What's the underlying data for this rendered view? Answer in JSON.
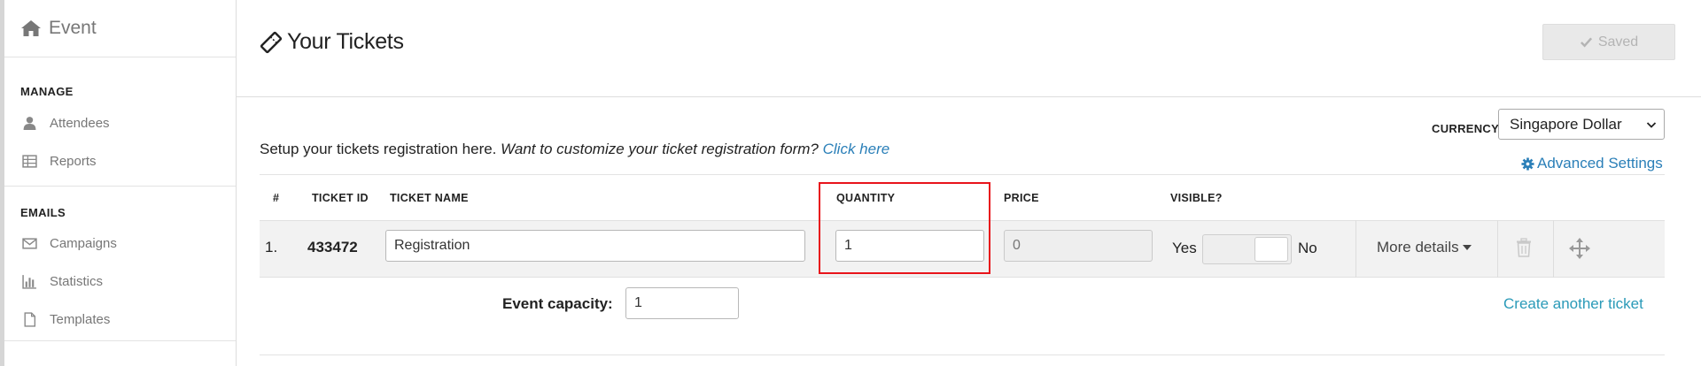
{
  "sidebar": {
    "title": "Event",
    "manage_heading": "MANAGE",
    "manage_items": [
      {
        "label": "Attendees",
        "icon": "user-icon"
      },
      {
        "label": "Reports",
        "icon": "table-icon"
      }
    ],
    "emails_heading": "EMAILS",
    "email_items": [
      {
        "label": "Campaigns",
        "icon": "envelope-icon"
      },
      {
        "label": "Statistics",
        "icon": "bar-chart-icon"
      },
      {
        "label": "Templates",
        "icon": "file-icon"
      }
    ]
  },
  "header": {
    "title": "Your Tickets",
    "saved_label": "Saved"
  },
  "currency": {
    "label": "CURRENCY",
    "selected": "Singapore Dollar"
  },
  "advanced_settings": "Advanced Settings",
  "setup": {
    "text": "Setup your tickets registration here.",
    "question": "Want to customize your ticket registration form?",
    "link": "Click here"
  },
  "table": {
    "headers": {
      "num": "#",
      "ticket_id": "TICKET ID",
      "ticket_name": "TICKET NAME",
      "quantity": "QUANTITY",
      "price": "PRICE",
      "visible": "VISIBLE?"
    },
    "row": {
      "index": "1.",
      "ticket_id": "433472",
      "ticket_name": "Registration",
      "quantity": "1",
      "price": "0",
      "visible_yes": "Yes",
      "visible_no": "No",
      "more_details": "More details"
    }
  },
  "capacity": {
    "label": "Event capacity:",
    "value": "1"
  },
  "create_ticket": "Create another ticket",
  "colors": {
    "link": "#2a7fb8",
    "highlight": "#e8141b"
  }
}
